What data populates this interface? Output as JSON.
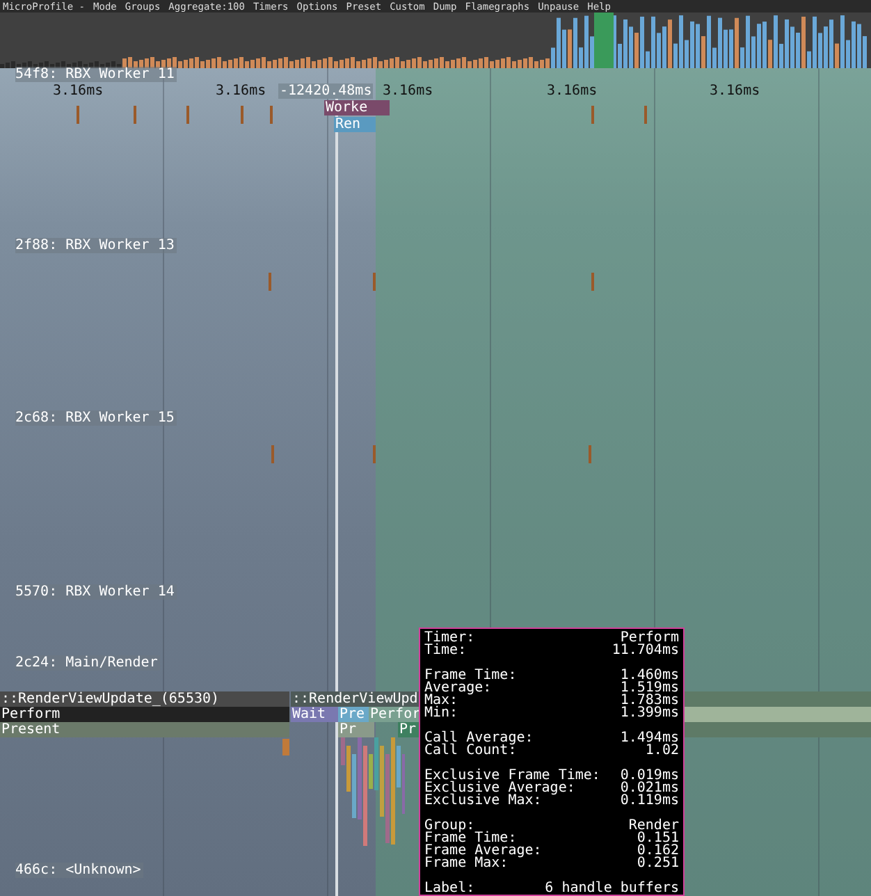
{
  "menu": {
    "items": [
      "MicroProfile -",
      "Mode",
      "Groups",
      "Aggregate:100",
      "Timers",
      "Options",
      "Preset",
      "Custom",
      "Dump",
      "Flamegraphs",
      "Unpause",
      "Help"
    ]
  },
  "timeline": {
    "ticks": [
      "3.16ms",
      "3.16ms",
      "-12420.48ms",
      "3.16ms",
      "3.16ms",
      "3.16ms"
    ],
    "threads": [
      "54f8: RBX Worker 11",
      "2f88: RBX Worker 13",
      "2c68: RBX Worker 15",
      "5570: RBX Worker 14",
      "2c24: Main/Render",
      "466c: <Unknown>"
    ],
    "markers": [
      {
        "label": "Worke",
        "color": "#7a4a6a"
      },
      {
        "label": "Ren",
        "color": "#5a9ac0"
      }
    ]
  },
  "flame": {
    "left": [
      {
        "label": "::RenderViewUpdate_(65530)",
        "color": "#4a4a4a"
      },
      {
        "label": "Perform",
        "color": "#222222"
      },
      {
        "label": "Present",
        "color": "#6b7a6a"
      }
    ],
    "right": [
      {
        "label": "::RenderViewUpd",
        "color": "#4e5a58"
      },
      {
        "label": "Wait",
        "color": "#7a78b0"
      },
      {
        "label": "Pre",
        "color": "#6aa8c8"
      },
      {
        "label": "Perfor",
        "color": "#7aa090"
      },
      {
        "label": "Pr",
        "color": "#8a9a8a"
      },
      {
        "label": "Pr",
        "color": "#3e8060"
      }
    ]
  },
  "tooltip": {
    "sections": [
      [
        {
          "label": "Timer:",
          "value": "Perform"
        },
        {
          "label": "Time:",
          "value": "11.704ms"
        }
      ],
      [
        {
          "label": "Frame Time:",
          "value": "1.460ms"
        },
        {
          "label": "Average:",
          "value": "1.519ms"
        },
        {
          "label": "Max:",
          "value": "1.783ms"
        },
        {
          "label": "Min:",
          "value": "1.399ms"
        }
      ],
      [
        {
          "label": "Call Average:",
          "value": "1.494ms"
        },
        {
          "label": "Call Count:",
          "value": "1.02"
        }
      ],
      [
        {
          "label": "Exclusive Frame Time:",
          "value": "0.019ms"
        },
        {
          "label": "Exclusive Average:",
          "value": "0.021ms"
        },
        {
          "label": "Exclusive Max:",
          "value": "0.119ms"
        }
      ],
      [
        {
          "label": "Group:",
          "value": "Render"
        },
        {
          "label": "Frame Time:",
          "value": "0.151"
        },
        {
          "label": "Frame Average:",
          "value": "0.162"
        },
        {
          "label": "Frame Max:",
          "value": "0.251"
        }
      ],
      [
        {
          "label": "Label:",
          "value": "6 handle buffers"
        }
      ]
    ]
  }
}
